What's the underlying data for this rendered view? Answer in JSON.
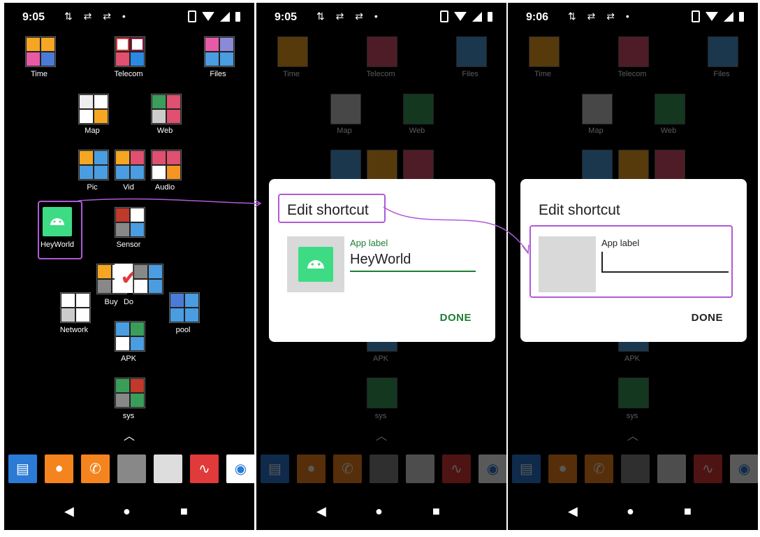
{
  "screens": [
    {
      "time": "9:05",
      "folders": [
        {
          "label": "Time"
        },
        {
          "label": "Telecom"
        },
        {
          "label": "Files"
        },
        {
          "label": "Map"
        },
        {
          "label": "Web"
        },
        {
          "label": "Pic"
        },
        {
          "label": "Vid"
        },
        {
          "label": "Audio"
        },
        {
          "label": "HeyWorld"
        },
        {
          "label": "Sensor"
        },
        {
          "label": "Buy"
        },
        {
          "label": "Do"
        },
        {
          "label": "Network"
        },
        {
          "label": "pool"
        },
        {
          "label": "APK"
        },
        {
          "label": "sys"
        }
      ]
    },
    {
      "time": "9:05",
      "dialog": {
        "title": "Edit shortcut",
        "field_label": "App label",
        "value": "HeyWorld",
        "done": "DONE"
      }
    },
    {
      "time": "9:06",
      "dialog": {
        "title": "Edit shortcut",
        "field_label": "App label",
        "value": "",
        "done": "DONE"
      }
    }
  ],
  "icons": {
    "status_left": "sync-icon, swap-icon, swap-icon, dot",
    "status_right": "phone-icon, wifi-icon, signal-icon, battery-icon",
    "dock": [
      "messages-icon",
      "contacts-icon",
      "phone-icon",
      "tools-folder",
      "dashcam-app",
      "recorder-icon",
      "camera-icon"
    ],
    "nav": [
      "back-icon",
      "home-icon",
      "recents-icon"
    ]
  },
  "colors": {
    "accent_green": "#1e7e34",
    "highlight": "#b05ad8",
    "android_green": "#3ddc84"
  }
}
